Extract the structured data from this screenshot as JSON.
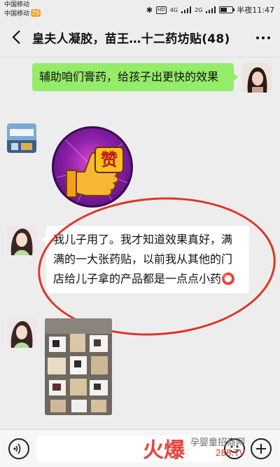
{
  "status_bar": {
    "carrier_1": "中国移动",
    "carrier_2": "中国移动",
    "carrier_badge": "25",
    "network_1": "4G",
    "network_2": "2G",
    "time": "半夜11:47"
  },
  "header": {
    "title": "皇夫人凝胶，苗王…十二药坊贴(48)"
  },
  "messages": [
    {
      "sender": "me",
      "type": "text",
      "text": "辅助咱们膏药，给孩子出更快的效果"
    },
    {
      "sender": "other",
      "type": "sticker",
      "sticker_text": "赞"
    },
    {
      "sender": "other",
      "type": "text",
      "text": "我儿子用了。我才知道效果真好，满满的一大张药贴，以前我从其他的门店给儿子拿的产品都是一点点小药⭕"
    },
    {
      "sender": "other",
      "type": "image"
    }
  ],
  "input_bar": {
    "placeholder": ""
  },
  "watermark": {
    "brand": "火爆",
    "tagline": "孕婴童招商网",
    "site": "288.TV"
  },
  "colors": {
    "my_bubble": "#95ec69",
    "other_bubble": "#ffffff",
    "annotation_circle": "#e0342a"
  }
}
